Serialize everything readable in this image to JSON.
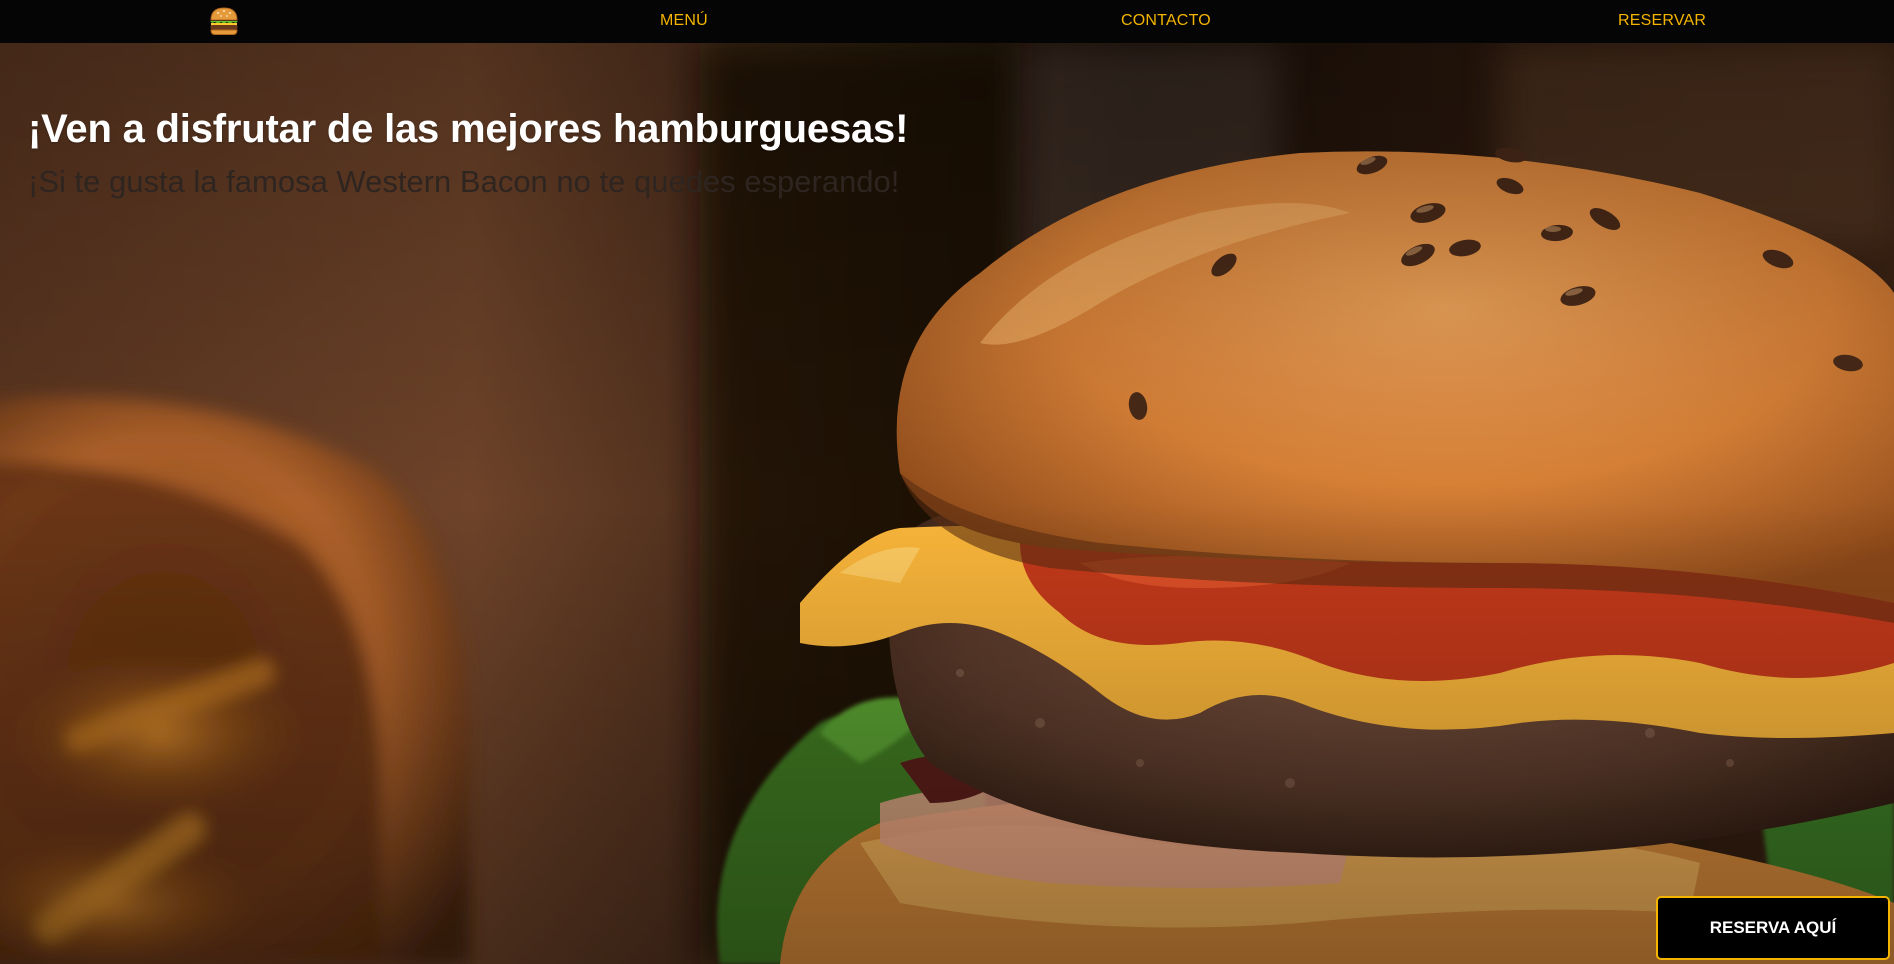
{
  "nav": {
    "logo_icon": "burger-icon",
    "items": [
      {
        "label": "MENÚ"
      },
      {
        "label": "CONTACTO"
      },
      {
        "label": "RESERVAR"
      }
    ]
  },
  "hero": {
    "title": "¡Ven a disfrutar de las mejores hamburguesas!",
    "subtitle": "¡Si te gusta la famosa Western Bacon no te quedes esperando!",
    "background_image": "burger-photo",
    "cta_label": "RESERVA AQUÍ"
  },
  "colors": {
    "nav_background": "#050505",
    "accent": "#f5b400",
    "title_text": "#ffffff",
    "subtitle_text": "#2f2520",
    "button_background": "#000000"
  }
}
